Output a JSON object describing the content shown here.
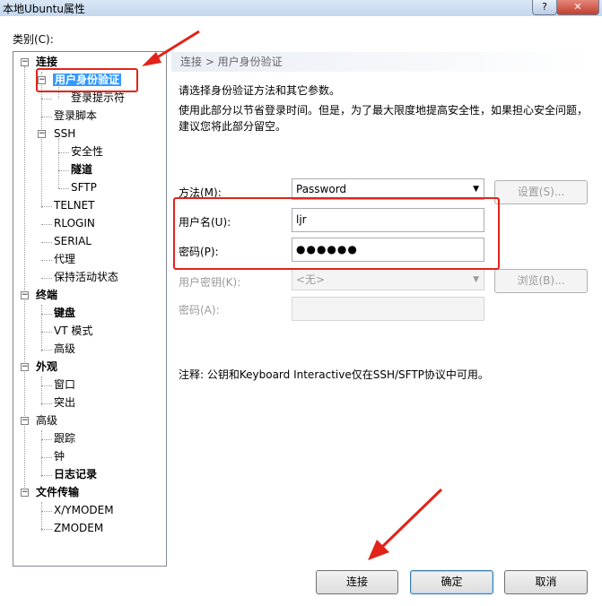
{
  "window": {
    "title": "本地Ubuntu属性",
    "help_glyph": "?",
    "close_glyph": "✕"
  },
  "category_label": "类别(C):",
  "tree": {
    "items": [
      {
        "label": "连接",
        "bold": true
      },
      {
        "label": "用户身份验证",
        "bold": true,
        "selected": true
      },
      {
        "label": "登录提示符"
      },
      {
        "label": "登录脚本"
      },
      {
        "label": "SSH"
      },
      {
        "label": "安全性"
      },
      {
        "label": "隧道",
        "bold": true
      },
      {
        "label": "SFTP"
      },
      {
        "label": "TELNET"
      },
      {
        "label": "RLOGIN"
      },
      {
        "label": "SERIAL"
      },
      {
        "label": "代理"
      },
      {
        "label": "保持活动状态"
      },
      {
        "label": "终端",
        "bold": true
      },
      {
        "label": "键盘",
        "bold": true
      },
      {
        "label": "VT 模式"
      },
      {
        "label": "高级"
      },
      {
        "label": "外观",
        "bold": true
      },
      {
        "label": "窗口"
      },
      {
        "label": "突出"
      },
      {
        "label": "高级"
      },
      {
        "label": "跟踪"
      },
      {
        "label": "钟"
      },
      {
        "label": "日志记录",
        "bold": true
      },
      {
        "label": "文件传输",
        "bold": true
      },
      {
        "label": "X/YMODEM"
      },
      {
        "label": "ZMODEM"
      }
    ]
  },
  "panel": {
    "breadcrumb": "连接 > 用户身份验证",
    "description": "请选择身份验证方法和其它参数。",
    "hint": "使用此部分以节省登录时间。但是，为了最大限度地提高安全性，如果担心安全问题，建议您将此部分留空。",
    "method_label": "方法(M):",
    "method_value": "Password",
    "settings_button": "设置(S)...",
    "username_label": "用户名(U):",
    "username_value": "ljr",
    "password_label": "密码(P):",
    "password_value": "●●●●●●",
    "user_key_label": "用户密钥(K):",
    "user_key_value": "<无>",
    "browse_button": "浏览(B)...",
    "passphrase_label": "密码(A):",
    "note": "注释: 公钥和Keyboard Interactive仅在SSH/SFTP协议中可用。"
  },
  "footer": {
    "connect": "连接",
    "ok": "确定",
    "cancel": "取消"
  },
  "annotation_color": "#e2231a"
}
